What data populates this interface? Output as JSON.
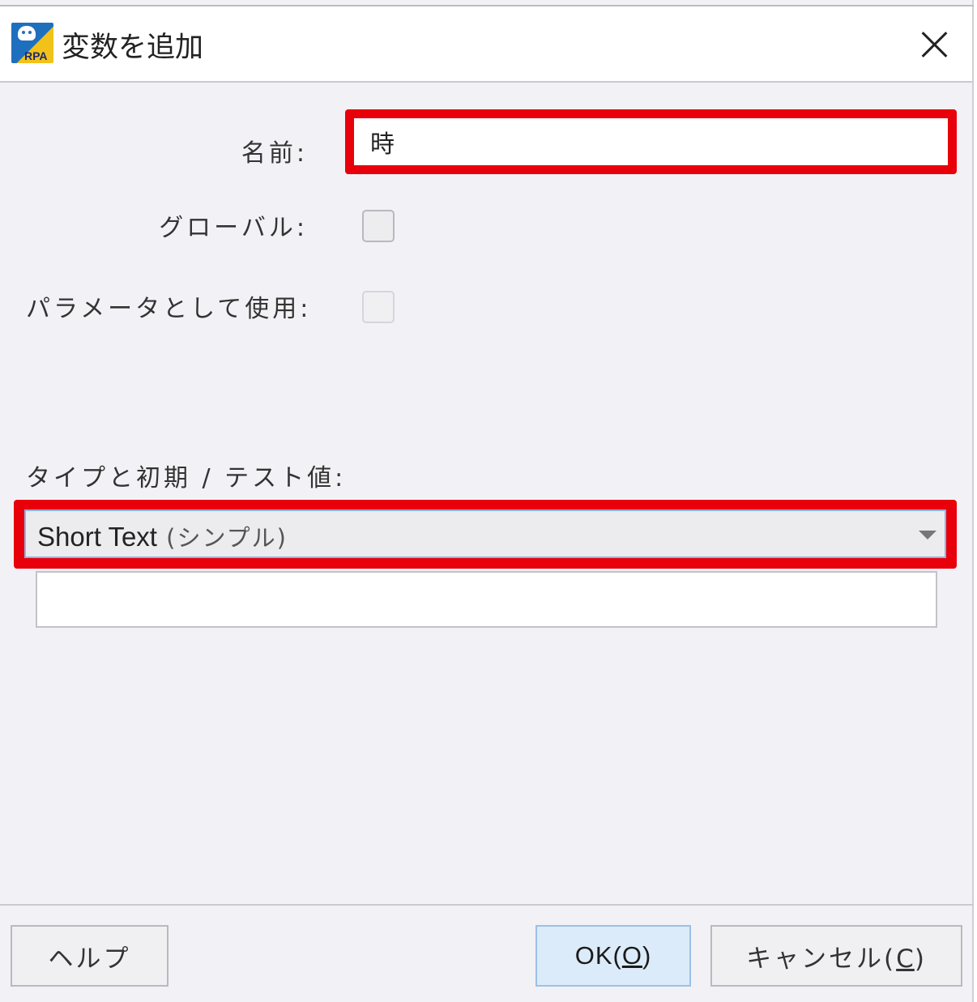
{
  "window": {
    "title": "変数を追加",
    "icon": "rpa-robot-icon",
    "icon_text": "RPA"
  },
  "form": {
    "name_label": "名前:",
    "name_value": "時",
    "global_label": "グローバル:",
    "global_checked": false,
    "param_label": "パラメータとして使用:",
    "param_checked": false,
    "param_enabled": false,
    "type_label": "タイプと初期 / テスト値:",
    "type_selected_main": "Short Text",
    "type_selected_sub": " (シンプル)",
    "initial_value": ""
  },
  "footer": {
    "help_label": "ヘルプ",
    "ok_prefix": "OK(",
    "ok_mnemonic": "O",
    "ok_suffix": ")",
    "cancel_prefix": "キャンセル(",
    "cancel_mnemonic": "C",
    "cancel_suffix": ")"
  },
  "colors": {
    "highlight": "#e8000b",
    "ok_button_bg": "#dcebf9",
    "dialog_bg": "#f2f2f6"
  }
}
